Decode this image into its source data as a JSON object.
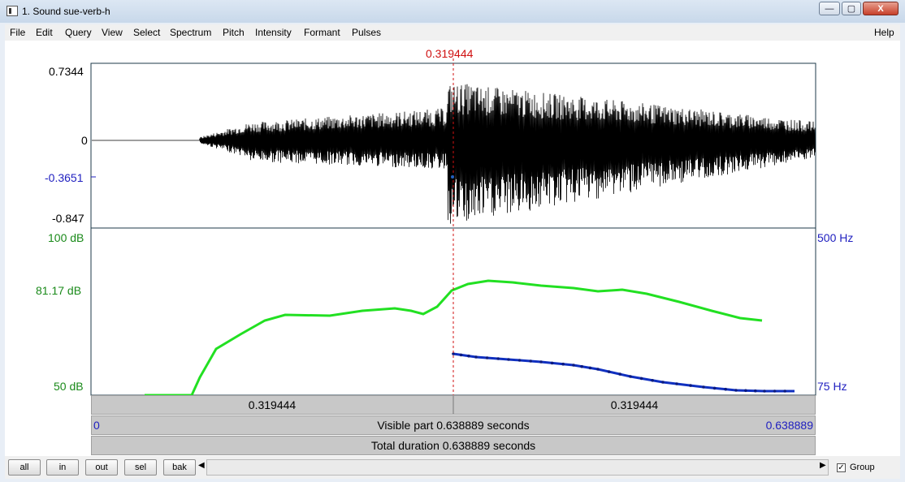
{
  "window": {
    "title": "1. Sound sue-verb-h",
    "controls": {
      "minimize": "—",
      "maximize": "▢",
      "close": "X"
    }
  },
  "menu": {
    "items": [
      "File",
      "Edit",
      "Query",
      "View",
      "Select",
      "Spectrum",
      "Pitch",
      "Intensity",
      "Formant",
      "Pulses"
    ],
    "help": "Help"
  },
  "cursor": {
    "time_label": "0.319444",
    "time": 0.319444
  },
  "waveform": {
    "y_labels": {
      "max": "0.7344",
      "zero": "0",
      "cursor_value": "-0.3651",
      "min": "-0.847"
    }
  },
  "analysis": {
    "left_labels": {
      "top": "100 dB",
      "mid": "81.17 dB",
      "bottom": "50 dB"
    },
    "right_labels": {
      "top": "500 Hz",
      "bottom": "75 Hz"
    },
    "intensity_color": "#22e022",
    "pitch_color": "#1030c0"
  },
  "selection": {
    "left_label": "0.319444",
    "right_label": "0.319444"
  },
  "visible": {
    "start": "0",
    "text": "Visible part 0.638889 seconds",
    "end": "0.638889"
  },
  "total": {
    "text": "Total duration 0.638889 seconds"
  },
  "bottom": {
    "buttons": [
      "all",
      "in",
      "out",
      "sel",
      "bak"
    ],
    "scroll_left": "◀",
    "scroll_right": "▶",
    "group_check": "✓",
    "group_label": "Group"
  }
}
